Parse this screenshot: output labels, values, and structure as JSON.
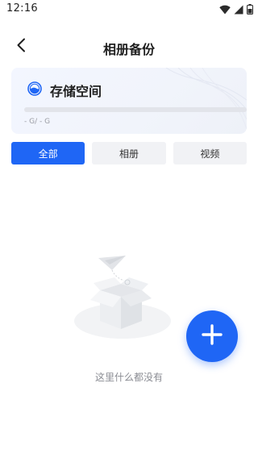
{
  "status_bar": {
    "time": "12:16",
    "icons": [
      "wifi-icon",
      "cellular-signal-icon",
      "battery-icon"
    ]
  },
  "header": {
    "back_icon": "chevron-left-icon",
    "title": "相册备份"
  },
  "storage": {
    "title": "存储空间",
    "icon": "storage-half-circle-icon",
    "usage": "- G/ - G",
    "progress_fraction": 0
  },
  "tabs": [
    {
      "label": "全部",
      "active": true
    },
    {
      "label": "相册",
      "active": false
    },
    {
      "label": "视频",
      "active": false
    }
  ],
  "empty_state": {
    "illustration": "empty-box-paper-plane-illustration",
    "text": "这里什么都没有"
  },
  "fab": {
    "icon": "plus-icon"
  },
  "colors": {
    "accent": "#1f66f5",
    "tab_inactive_bg": "#f1f2f5",
    "empty_text": "#8a8c93"
  }
}
